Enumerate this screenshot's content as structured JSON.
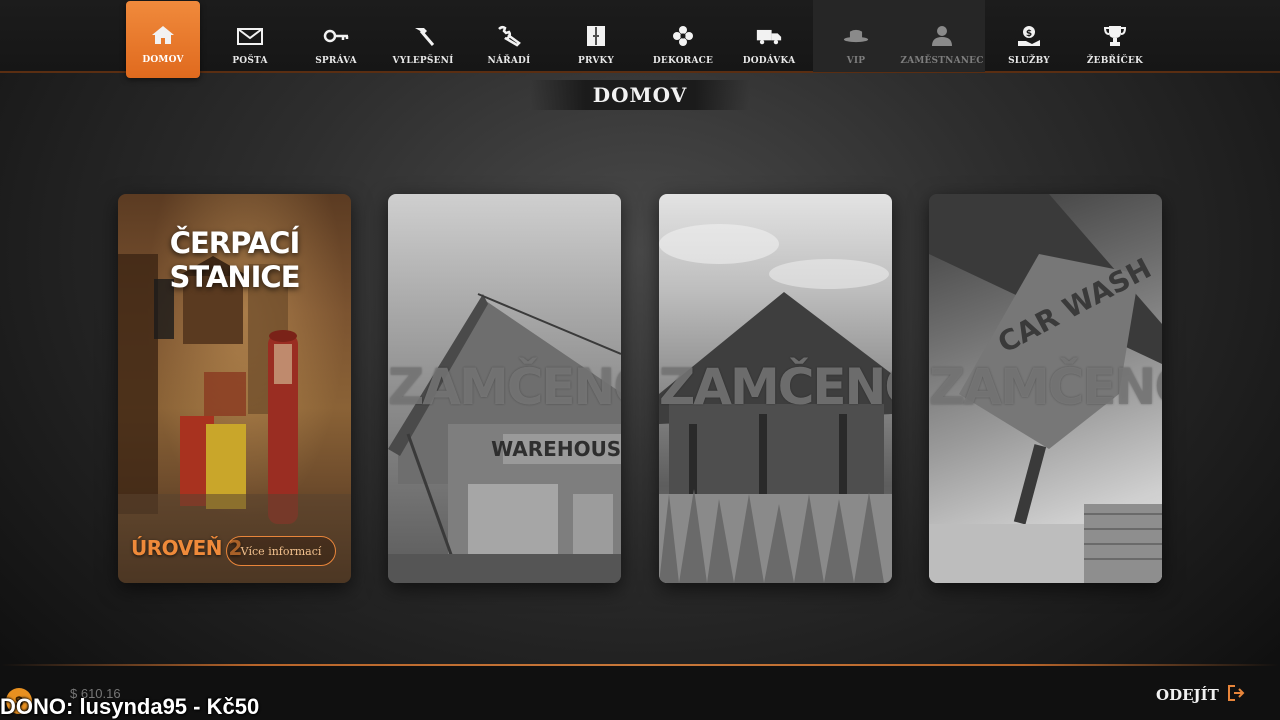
{
  "nav": {
    "items": [
      {
        "label": "DOMOV",
        "icon": "home-icon",
        "active": true
      },
      {
        "label": "POŠTA",
        "icon": "mail-icon"
      },
      {
        "label": "SPRÁVA",
        "icon": "key-icon"
      },
      {
        "label": "VYLEPŠENÍ",
        "icon": "hammer-icon"
      },
      {
        "label": "NÁŘADÍ",
        "icon": "wrench-icon"
      },
      {
        "label": "PRVKY",
        "icon": "cabinet-icon"
      },
      {
        "label": "DEKORACE",
        "icon": "flower-icon"
      },
      {
        "label": "DODÁVKA",
        "icon": "truck-icon"
      },
      {
        "label": "VIP",
        "icon": "hat-icon",
        "locked": true
      },
      {
        "label": "ZAMĚSTNANEC",
        "icon": "employee-icon",
        "locked": true
      },
      {
        "label": "SLUŽBY",
        "icon": "money-hand-icon"
      },
      {
        "label": "ŽEBŘÍČEK",
        "icon": "trophy-icon"
      }
    ],
    "accent_color": "#e8772a"
  },
  "page": {
    "title": "DOMOV"
  },
  "cards": [
    {
      "title": "ČERPACÍ STANICE",
      "level": "ÚROVEŇ 2",
      "more_label": "Více informací",
      "unlocked": true
    },
    {
      "locked_label": "ZAMČENO",
      "sign_text": "WAREHOUSE",
      "unlocked": false
    },
    {
      "locked_label": "ZAMČENO",
      "unlocked": false
    },
    {
      "locked_label": "ZAMČENO",
      "sign_text": "CAR WASH",
      "unlocked": false
    }
  ],
  "footer": {
    "money": "$ 610.16",
    "donation": "DONO: lusynda95 - Kč50",
    "exit_label": "ODEJÍT"
  }
}
